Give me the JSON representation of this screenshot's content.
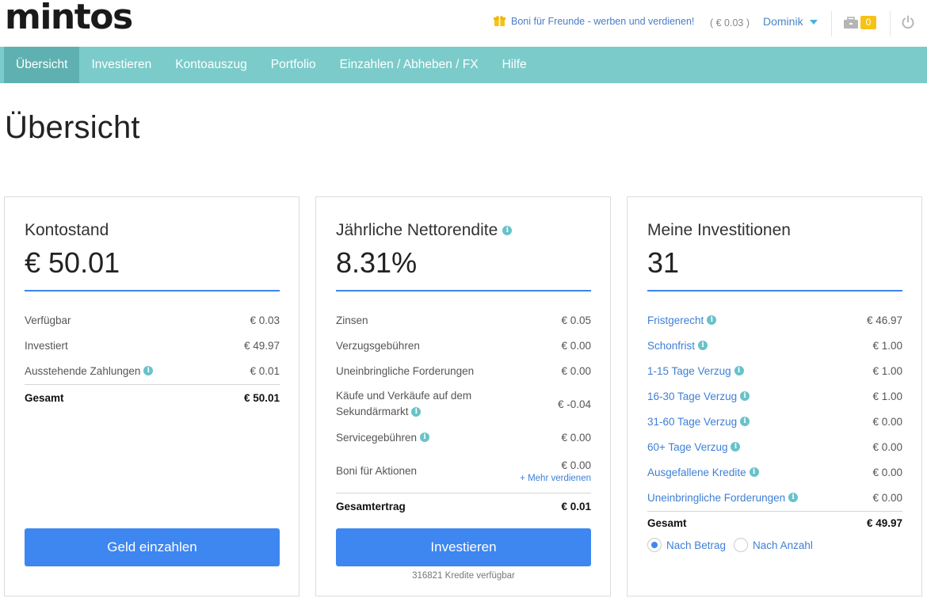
{
  "header": {
    "logo": "mintos",
    "bonus_text": "Boni für Freunde - werben und verdienen!",
    "balance": "( € 0.03 )",
    "user": "Dominik",
    "badge_count": "0",
    "icons": [
      "gift-icon",
      "chevron-down-icon",
      "briefcase-icon",
      "power-icon"
    ]
  },
  "nav": {
    "items": [
      "Übersicht",
      "Investieren",
      "Kontoauszug",
      "Portfolio",
      "Einzahlen / Abheben / FX",
      "Hilfe"
    ]
  },
  "page_title": "Übersicht",
  "account": {
    "title": "Kontostand",
    "amount": "€ 50.01",
    "rows": [
      {
        "label": "Verfügbar",
        "value": "€ 0.03"
      },
      {
        "label": "Investiert",
        "value": "€ 49.97"
      },
      {
        "label": "Ausstehende Zahlungen",
        "value": "€ 0.01"
      }
    ],
    "total_label": "Gesamt",
    "total_value": "€ 50.01",
    "button": "Geld einzahlen"
  },
  "yield": {
    "title": "Jährliche Nettorendite",
    "amount": "8.31%",
    "rows": [
      {
        "label": "Zinsen",
        "value": "€ 0.05"
      },
      {
        "label": "Verzugsgebühren",
        "value": "€ 0.00"
      },
      {
        "label": "Uneinbringliche Forderungen",
        "value": "€ 0.00"
      },
      {
        "label": "Käufe und Verkäufe auf dem Sekundärmarkt",
        "value": "€ -0.04"
      },
      {
        "label": "Servicegebühren",
        "value": "€ 0.00"
      },
      {
        "label": "Boni für Aktionen",
        "value": "€ 0.00"
      }
    ],
    "more_link": "+ Mehr verdienen",
    "total_label": "Gesamtertrag",
    "total_value": "€ 0.01",
    "button": "Investieren",
    "available": "316821 Kredite verfügbar"
  },
  "investments": {
    "title": "Meine Investitionen",
    "amount": "31",
    "rows": [
      {
        "label": "Fristgerecht",
        "value": "€ 46.97"
      },
      {
        "label": "Schonfrist",
        "value": "€ 1.00"
      },
      {
        "label": "1-15 Tage Verzug",
        "value": "€ 1.00"
      },
      {
        "label": "16-30 Tage Verzug",
        "value": "€ 1.00"
      },
      {
        "label": "31-60 Tage Verzug",
        "value": "€ 0.00"
      },
      {
        "label": "60+ Tage Verzug",
        "value": "€ 0.00"
      },
      {
        "label": "Ausgefallene Kredite",
        "value": "€ 0.00"
      },
      {
        "label": "Uneinbringliche Forderungen",
        "value": "€ 0.00"
      }
    ],
    "total_label": "Gesamt",
    "total_value": "€ 49.97",
    "radio_by_amount": "Nach Betrag",
    "radio_by_count": "Nach Anzahl",
    "radio_selected": "Nach Betrag"
  },
  "colors": {
    "nav_bg": "#7bcbca",
    "nav_active": "#5fb0b0",
    "accent_blue": "#3e86f0",
    "link_blue": "#3e7fd6",
    "badge_yellow": "#f6c216"
  }
}
